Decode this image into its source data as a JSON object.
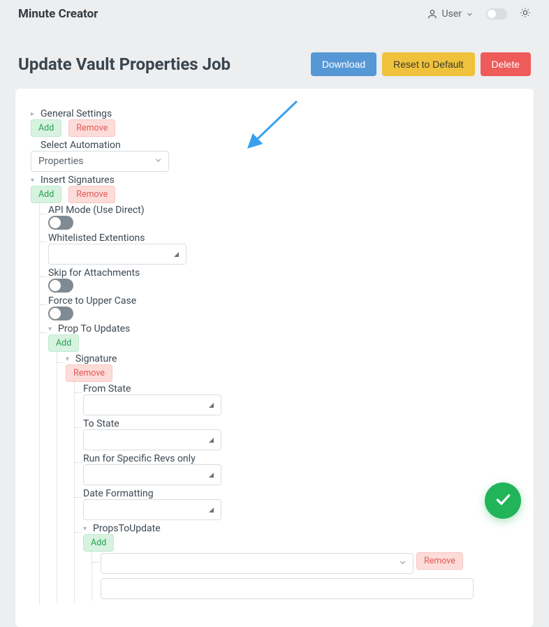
{
  "brand": "Minute Creator",
  "header": {
    "user_label": "User"
  },
  "page": {
    "title": "Update Vault Properties Job",
    "actions": {
      "download": "Download",
      "reset": "Reset to Default",
      "delete": "Delete"
    }
  },
  "buttons": {
    "add": "Add",
    "remove": "Remove"
  },
  "tree": {
    "general_settings": "General Settings",
    "select_automation": {
      "label": "Select Automation",
      "value": "Properties"
    },
    "insert_signatures": "Insert Signatures",
    "api_mode": "API Mode (Use Direct)",
    "whitelisted": "Whitelisted Extentions",
    "skip_attachments": "Skip for Attachments",
    "force_upper": "Force to Upper Case",
    "prop_to_updates": "Prop To Updates",
    "signature": "Signature",
    "from_state": "From State",
    "to_state": "To State",
    "run_specific": "Run for Specific Revs only",
    "date_formatting": "Date Formatting",
    "props_to_update": "PropsToUpdate"
  }
}
